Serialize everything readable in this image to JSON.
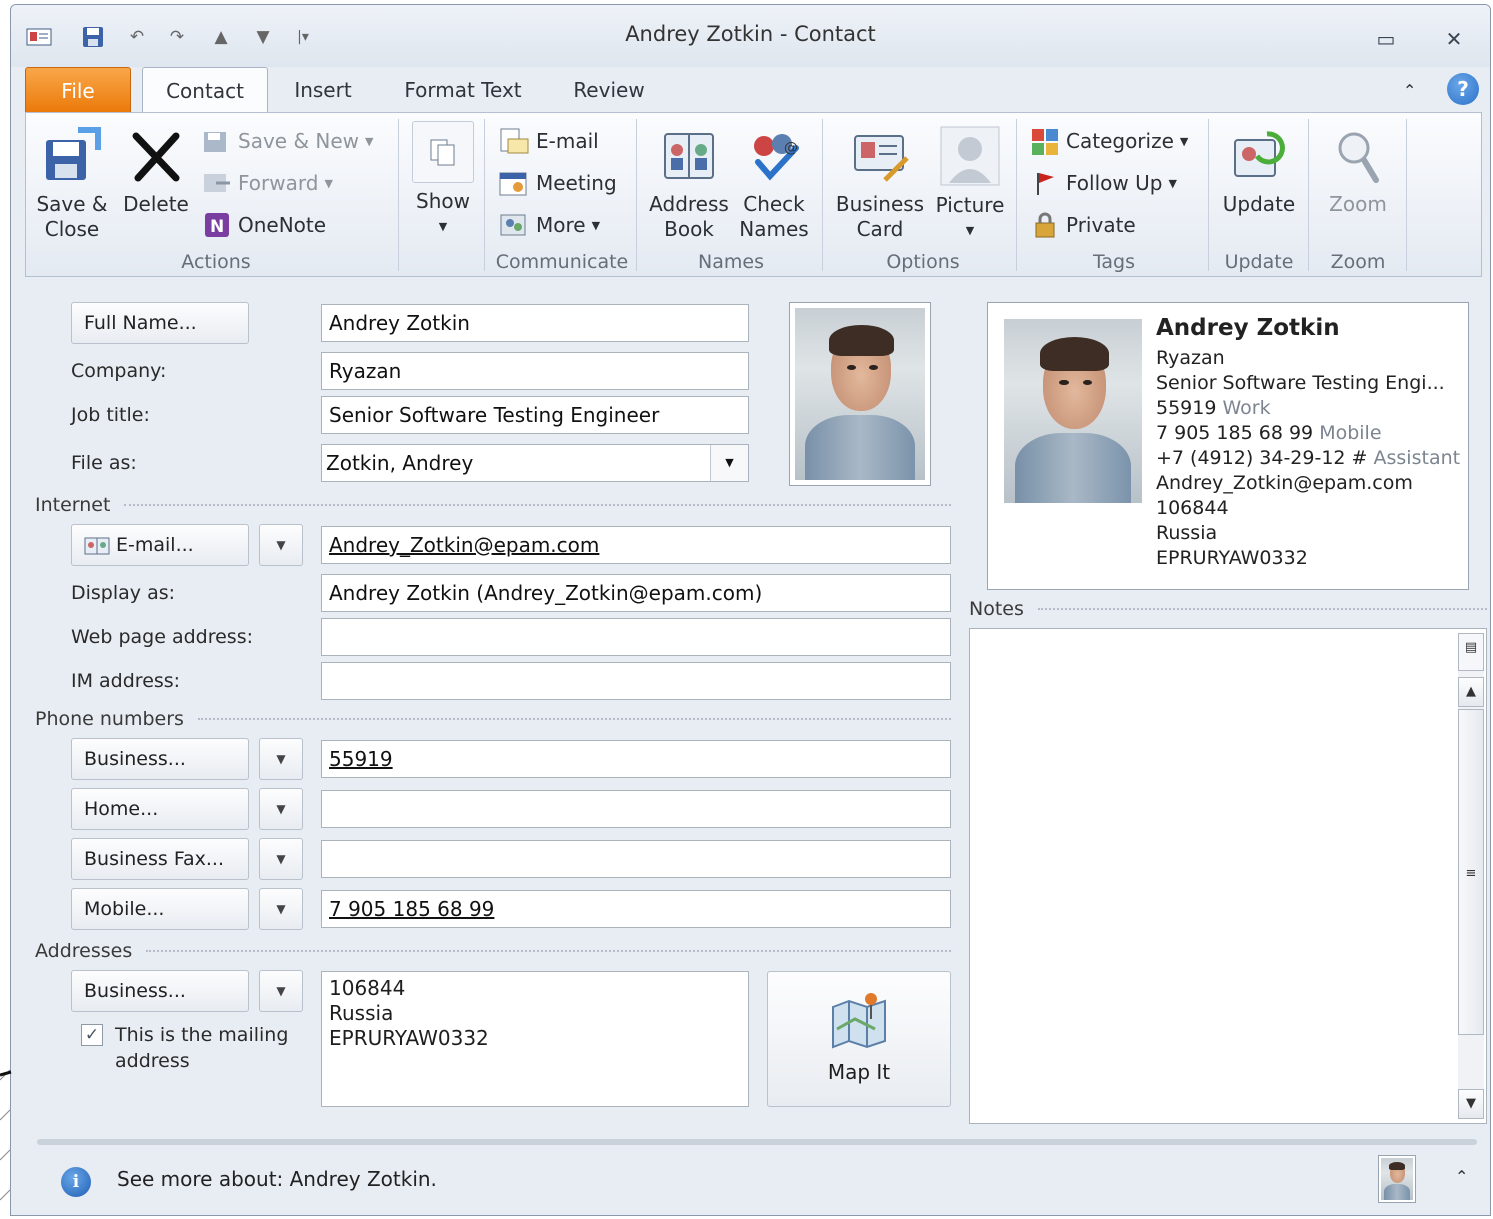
{
  "window": {
    "title": "Andrey Zotkin  -  Contact"
  },
  "quick_access": {
    "icons": [
      "contact-card-icon",
      "save-icon",
      "undo-icon",
      "redo-icon",
      "up-arrow-icon",
      "down-arrow-icon",
      "customize-icon"
    ]
  },
  "tabs": [
    {
      "label": "File"
    },
    {
      "label": "Contact"
    },
    {
      "label": "Insert"
    },
    {
      "label": "Format Text"
    },
    {
      "label": "Review"
    }
  ],
  "ribbon": {
    "actions": {
      "save_close": [
        "Save &",
        "Close"
      ],
      "delete": "Delete",
      "save_new": "Save & New",
      "forward": "Forward",
      "onenote": "OneNote",
      "label": "Actions"
    },
    "show": {
      "label": "Show"
    },
    "communicate": {
      "email": "E-mail",
      "meeting": "Meeting",
      "more": "More",
      "label": "Communicate"
    },
    "names": {
      "address_book": [
        "Address",
        "Book"
      ],
      "check_names": [
        "Check",
        "Names"
      ],
      "label": "Names"
    },
    "options": {
      "business_card": [
        "Business",
        "Card"
      ],
      "picture": "Picture",
      "label": "Options"
    },
    "tags": {
      "categorize": "Categorize",
      "follow_up": "Follow Up",
      "private": "Private",
      "label": "Tags"
    },
    "update": {
      "button": "Update",
      "label": "Update"
    },
    "zoom": {
      "button": "Zoom",
      "label": "Zoom"
    }
  },
  "form": {
    "full_name_btn": "Full Name...",
    "full_name": "Andrey Zotkin",
    "company_label": "Company:",
    "company": "Ryazan",
    "job_title_label": "Job title:",
    "job_title": "Senior Software Testing Engineer",
    "file_as_label": "File as:",
    "file_as": "Zotkin, Andrey",
    "internet_section": "Internet",
    "email_btn": "E-mail...",
    "email": "Andrey_Zotkin@epam.com",
    "display_as_label": "Display as:",
    "display_as": "Andrey Zotkin (Andrey_Zotkin@epam.com)",
    "web_label": "Web page address:",
    "web": "",
    "im_label": "IM address:",
    "im": "",
    "phone_section": "Phone numbers",
    "business_btn": "Business...",
    "business_phone": "55919",
    "home_btn": "Home...",
    "home_phone": "",
    "fax_btn": "Business Fax...",
    "fax": "",
    "mobile_btn": "Mobile...",
    "mobile": "7 905 185 68 99",
    "addresses_section": "Addresses",
    "address_btn": "Business...",
    "mailing_label": [
      "This is the mailing",
      "address"
    ],
    "mailing_checked": true,
    "address_lines": [
      "106844",
      "Russia",
      "EPRURYAW0332"
    ],
    "map_it": "Map It",
    "notes_label": "Notes"
  },
  "card": {
    "name": "Andrey Zotkin",
    "company": "Ryazan",
    "title": "Senior Software Testing Engi...",
    "work_phone": "55919",
    "work_tag": "Work",
    "mobile_phone": "7 905 185 68 99",
    "mobile_tag": "Mobile",
    "assistant_phone": "+7 (4912) 34-29-12 #",
    "assistant_tag": "Assistant",
    "email": "Andrey_Zotkin@epam.com",
    "zip": "106844",
    "country": "Russia",
    "location": "EPRURYAW0332"
  },
  "people_pane": {
    "text": "See more about: Andrey Zotkin."
  },
  "colors": {
    "file_tab": "#eb7a0a",
    "help": "#2b72c9"
  }
}
